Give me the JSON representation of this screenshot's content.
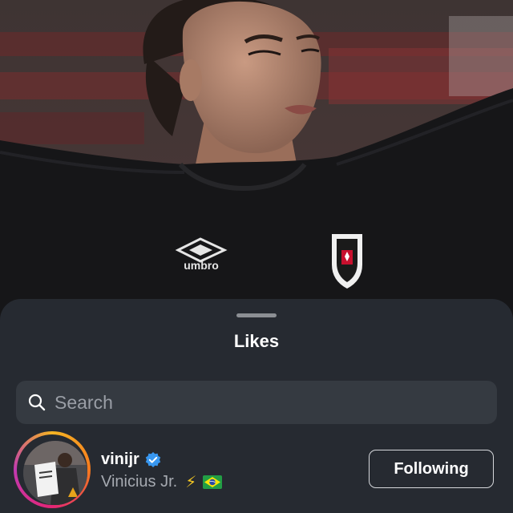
{
  "sheet": {
    "title": "Likes"
  },
  "search": {
    "placeholder": "Search",
    "icon": "search-icon"
  },
  "likes": [
    {
      "username": "vinijr",
      "verified": true,
      "full_name": "Vinicius Jr.",
      "emoji": "⚡",
      "flag": "brazil-flag-icon",
      "button_label": "Following"
    }
  ],
  "photo": {
    "shirt_brand": "umbro"
  },
  "colors": {
    "sheet_bg": "#262a31",
    "search_bg": "#353a41",
    "verified_blue": "#3897f0",
    "bolt_yellow": "#f3c623"
  }
}
